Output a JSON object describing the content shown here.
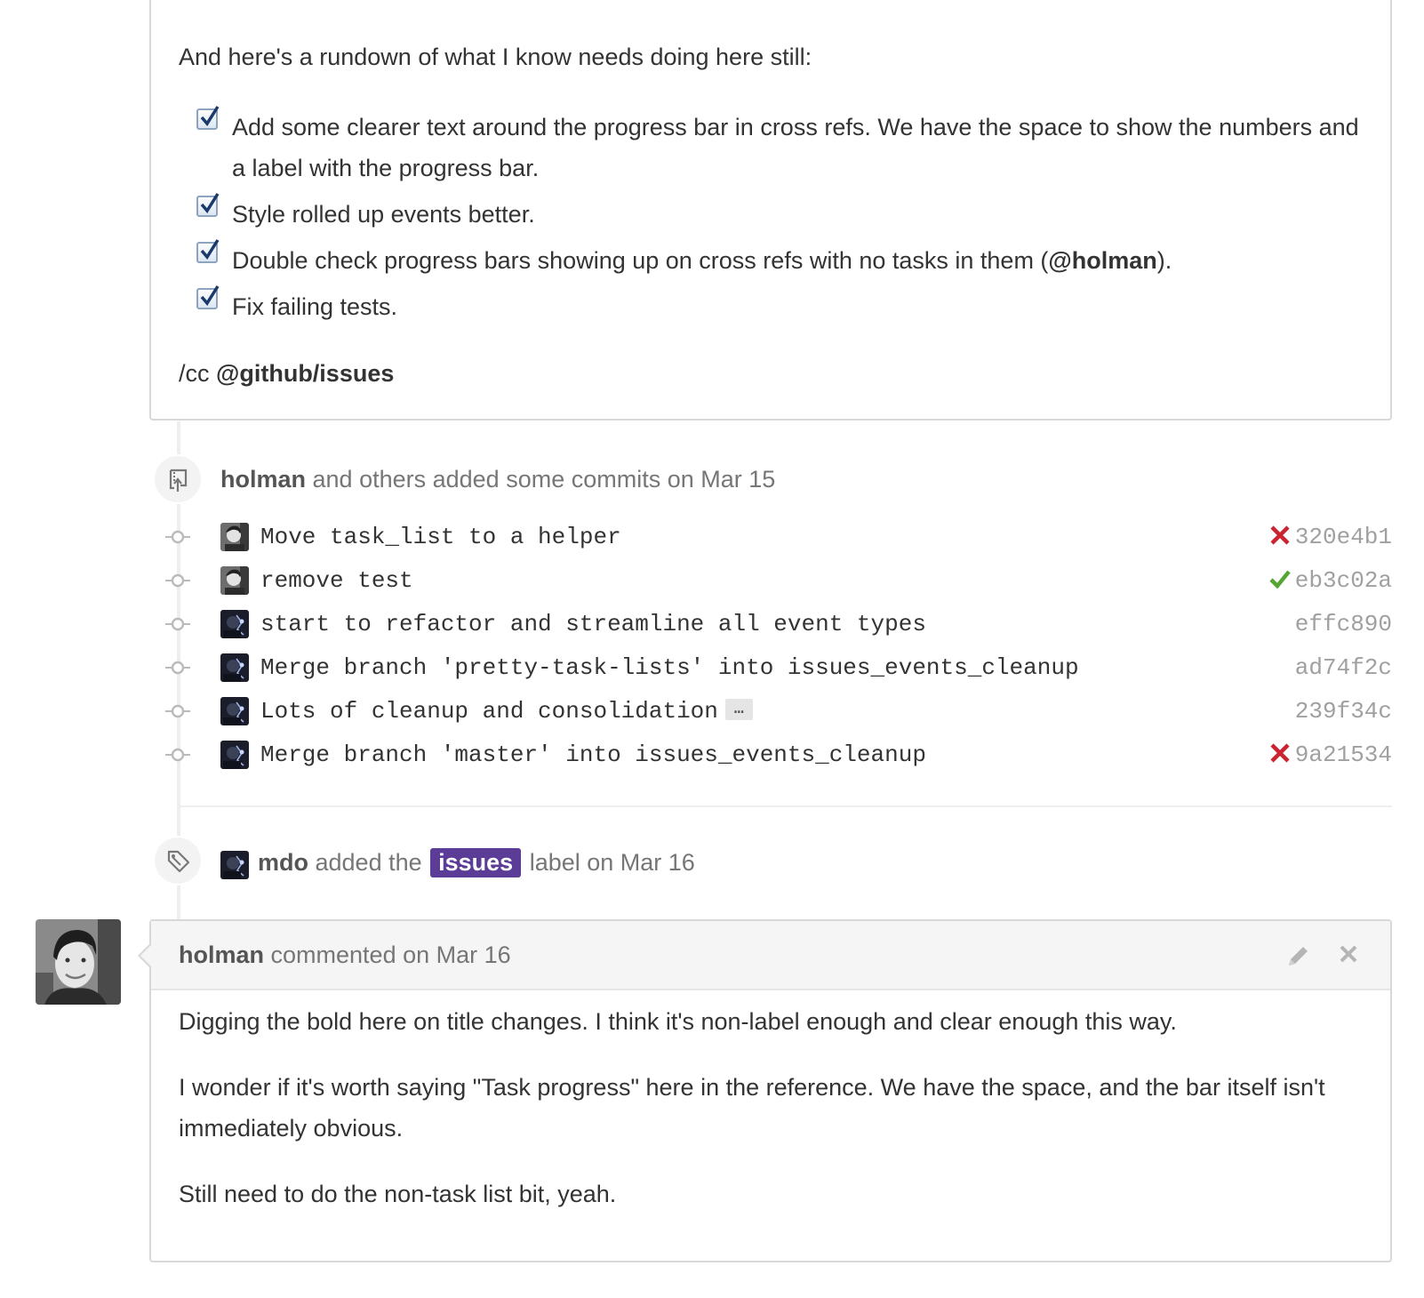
{
  "top_comment": {
    "intro": "And here's a rundown of what I know needs doing here still:",
    "tasks": [
      {
        "text": "Add some clearer text around the progress bar in cross refs. We have the space to show the numbers and a label with the progress bar.",
        "checked": true
      },
      {
        "text": "Style rolled up events better.",
        "checked": true
      },
      {
        "text_before": "Double check progress bars showing up on cross refs with no tasks in them (",
        "mention": "@holman",
        "text_after": ").",
        "checked": true
      },
      {
        "text": "Fix failing tests.",
        "checked": true
      }
    ],
    "cc_prefix": "/cc ",
    "cc_mention": "@github/issues"
  },
  "commits_event": {
    "author": "holman",
    "text": " and others added some commits on Mar 15",
    "commits": [
      {
        "message": "Move task_list to a helper",
        "sha": "320e4b1",
        "status": "failure",
        "avatar": "holman"
      },
      {
        "message": "remove test",
        "sha": "eb3c02a",
        "status": "success",
        "avatar": "holman"
      },
      {
        "message": "start to refactor and streamline all event types",
        "sha": "effc890",
        "status": "none",
        "avatar": "mdo"
      },
      {
        "message": "Merge branch 'pretty-task-lists' into issues_events_cleanup",
        "sha": "ad74f2c",
        "status": "none",
        "avatar": "mdo"
      },
      {
        "message": "Lots of cleanup and consolidation",
        "sha": "239f34c",
        "status": "none",
        "avatar": "mdo",
        "has_more": true,
        "more_label": "…"
      },
      {
        "message": "Merge branch 'master' into issues_events_cleanup",
        "sha": "9a21534",
        "status": "failure",
        "avatar": "mdo"
      }
    ]
  },
  "label_event": {
    "author": "mdo",
    "text_before": " added the ",
    "label": "issues",
    "label_color": "#5b3c96",
    "text_after": " label on Mar 16"
  },
  "second_comment": {
    "author": "holman",
    "header_text": " commented on Mar 16",
    "paragraphs": [
      "Digging the bold here on title changes. I think it's non-label enough and clear enough this way.",
      "I wonder if it's worth saying \"Task progress\" here in the reference. We have the space, and the bar itself isn't immediately obvious.",
      "Still need to do the non-task list bit, yeah."
    ]
  },
  "colors": {
    "failure": "#cb2431",
    "success": "#55a532",
    "label": "#5b3c96"
  }
}
